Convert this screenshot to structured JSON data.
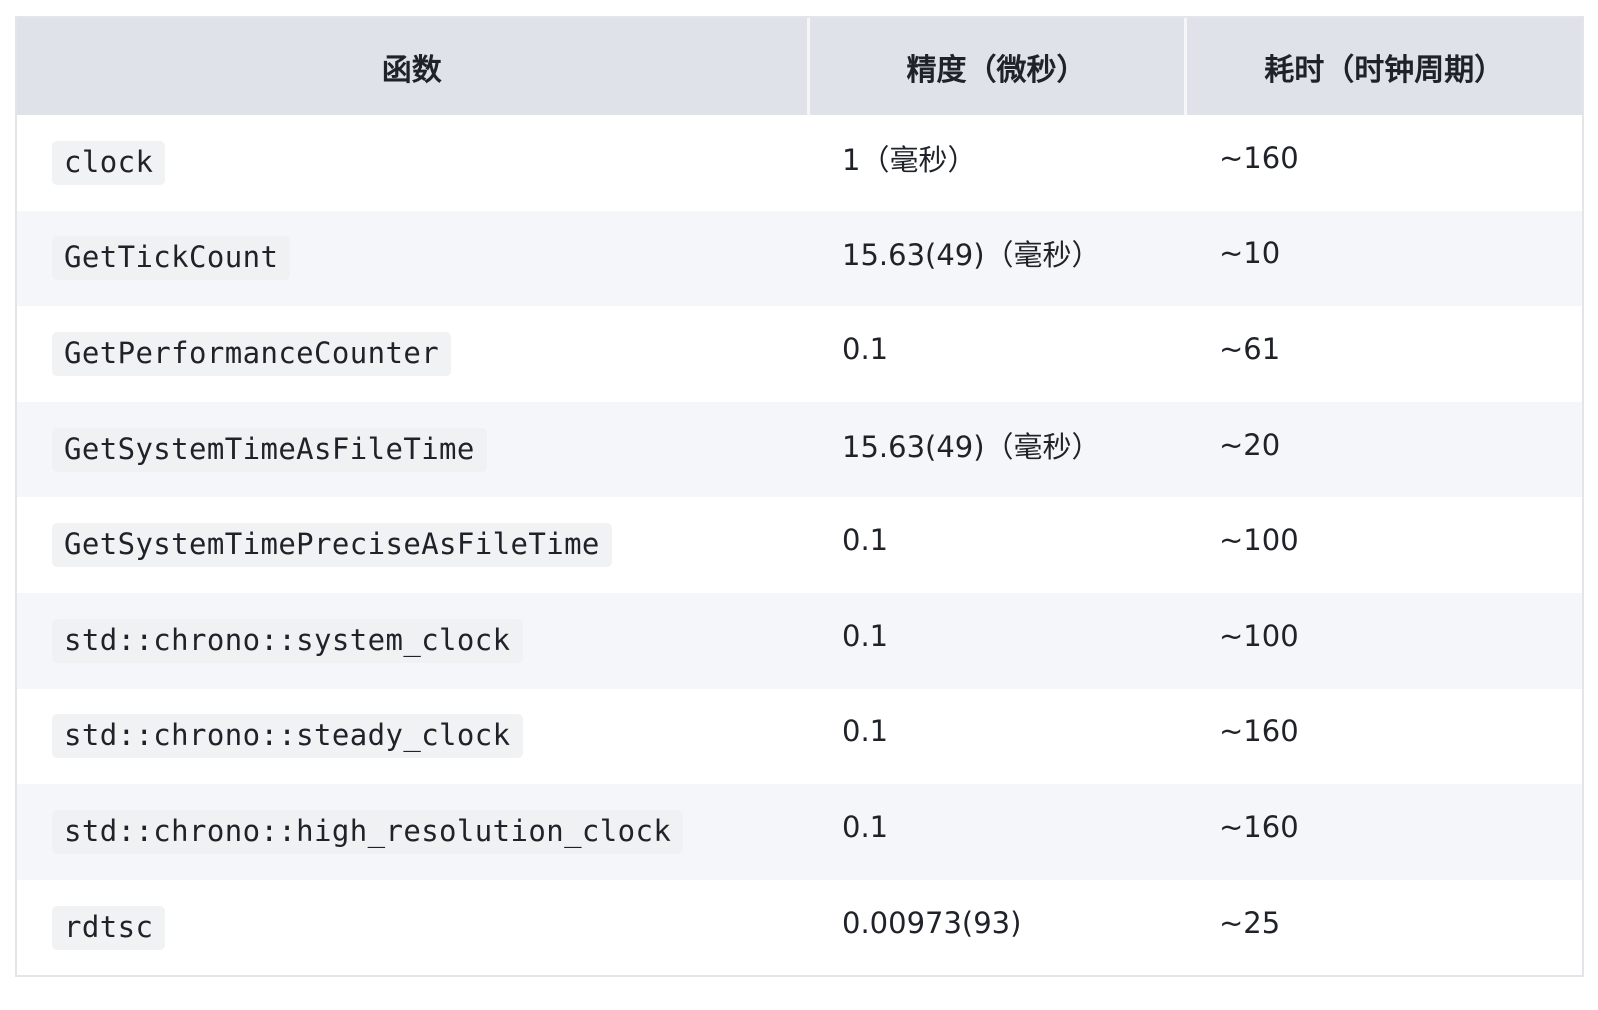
{
  "table": {
    "headers": [
      "函数",
      "精度（微秒）",
      "耗时（时钟周期）"
    ],
    "rows": [
      {
        "function": "clock",
        "precision": "1（毫秒）",
        "cost": "~160"
      },
      {
        "function": "GetTickCount",
        "precision": "15.63(49)（毫秒）",
        "cost": "~10"
      },
      {
        "function": "GetPerformanceCounter",
        "precision": "0.1",
        "cost": "~61"
      },
      {
        "function": "GetSystemTimeAsFileTime",
        "precision": "15.63(49)（毫秒）",
        "cost": "~20"
      },
      {
        "function": "GetSystemTimePreciseAsFileTime",
        "precision": "0.1",
        "cost": "~100"
      },
      {
        "function": "std::chrono::system_clock",
        "precision": "0.1",
        "cost": "~100"
      },
      {
        "function": "std::chrono::steady_clock",
        "precision": "0.1",
        "cost": "~160"
      },
      {
        "function": "std::chrono::high_resolution_clock",
        "precision": "0.1",
        "cost": "~160"
      },
      {
        "function": "rdtsc",
        "precision": "0.00973(93)",
        "cost": "~25"
      }
    ]
  },
  "colors": {
    "header_bg": "#dfe2e8",
    "stripe_bg": "#f5f6f9",
    "code_bg": "#f1f2f4",
    "text": "#1f2329",
    "border": "#e3e5ea"
  }
}
